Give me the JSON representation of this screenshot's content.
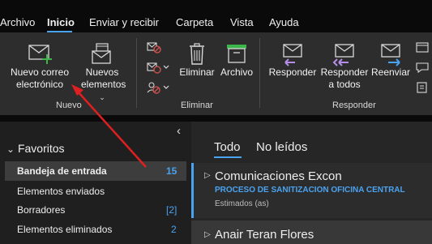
{
  "menu": {
    "items": [
      "Archivo",
      "Inicio",
      "Enviar y recibir",
      "Carpeta",
      "Vista",
      "Ayuda"
    ]
  },
  "ribbon": {
    "nuevo": {
      "new_email_line1": "Nuevo correo",
      "new_email_line2": "electrónico",
      "new_items_line1": "Nuevos",
      "new_items_line2": "elementos",
      "label": "Nuevo"
    },
    "eliminar": {
      "delete_label": "Eliminar",
      "archive_label": "Archivo",
      "label": "Eliminar"
    },
    "responder": {
      "reply_label": "Responder",
      "reply_all_line1": "Responder",
      "reply_all_line2": "a todos",
      "forward_label": "Reenviar",
      "label": "Responder"
    }
  },
  "sidebar": {
    "collapse_glyph": "‹",
    "favorites_label": "Favoritos",
    "folders": [
      {
        "name": "Bandeja de entrada",
        "count": "15"
      },
      {
        "name": "Elementos enviados",
        "count": ""
      },
      {
        "name": "Borradores",
        "count": "[2]"
      },
      {
        "name": "Elementos eliminados",
        "count": "2"
      }
    ]
  },
  "mail": {
    "tabs": [
      "Todo",
      "No leídos"
    ],
    "items": [
      {
        "sender": "Comunicaciones Excon",
        "subject": "PROCESO DE SANITIZACION OFICINA CENTRAL",
        "preview": "Estimados (as)"
      },
      {
        "sender": "Anair Teran Flores",
        "subject": "",
        "preview": ""
      }
    ]
  },
  "colors": {
    "accent": "#4aa3f0",
    "annotation_arrow": "#e02020",
    "new_plus": "#3cb54a",
    "archive_top": "#3cb54a",
    "reply_purple": "#b48ee8",
    "forward_blue": "#4aa3f0",
    "delete_red": "#d9534f"
  }
}
